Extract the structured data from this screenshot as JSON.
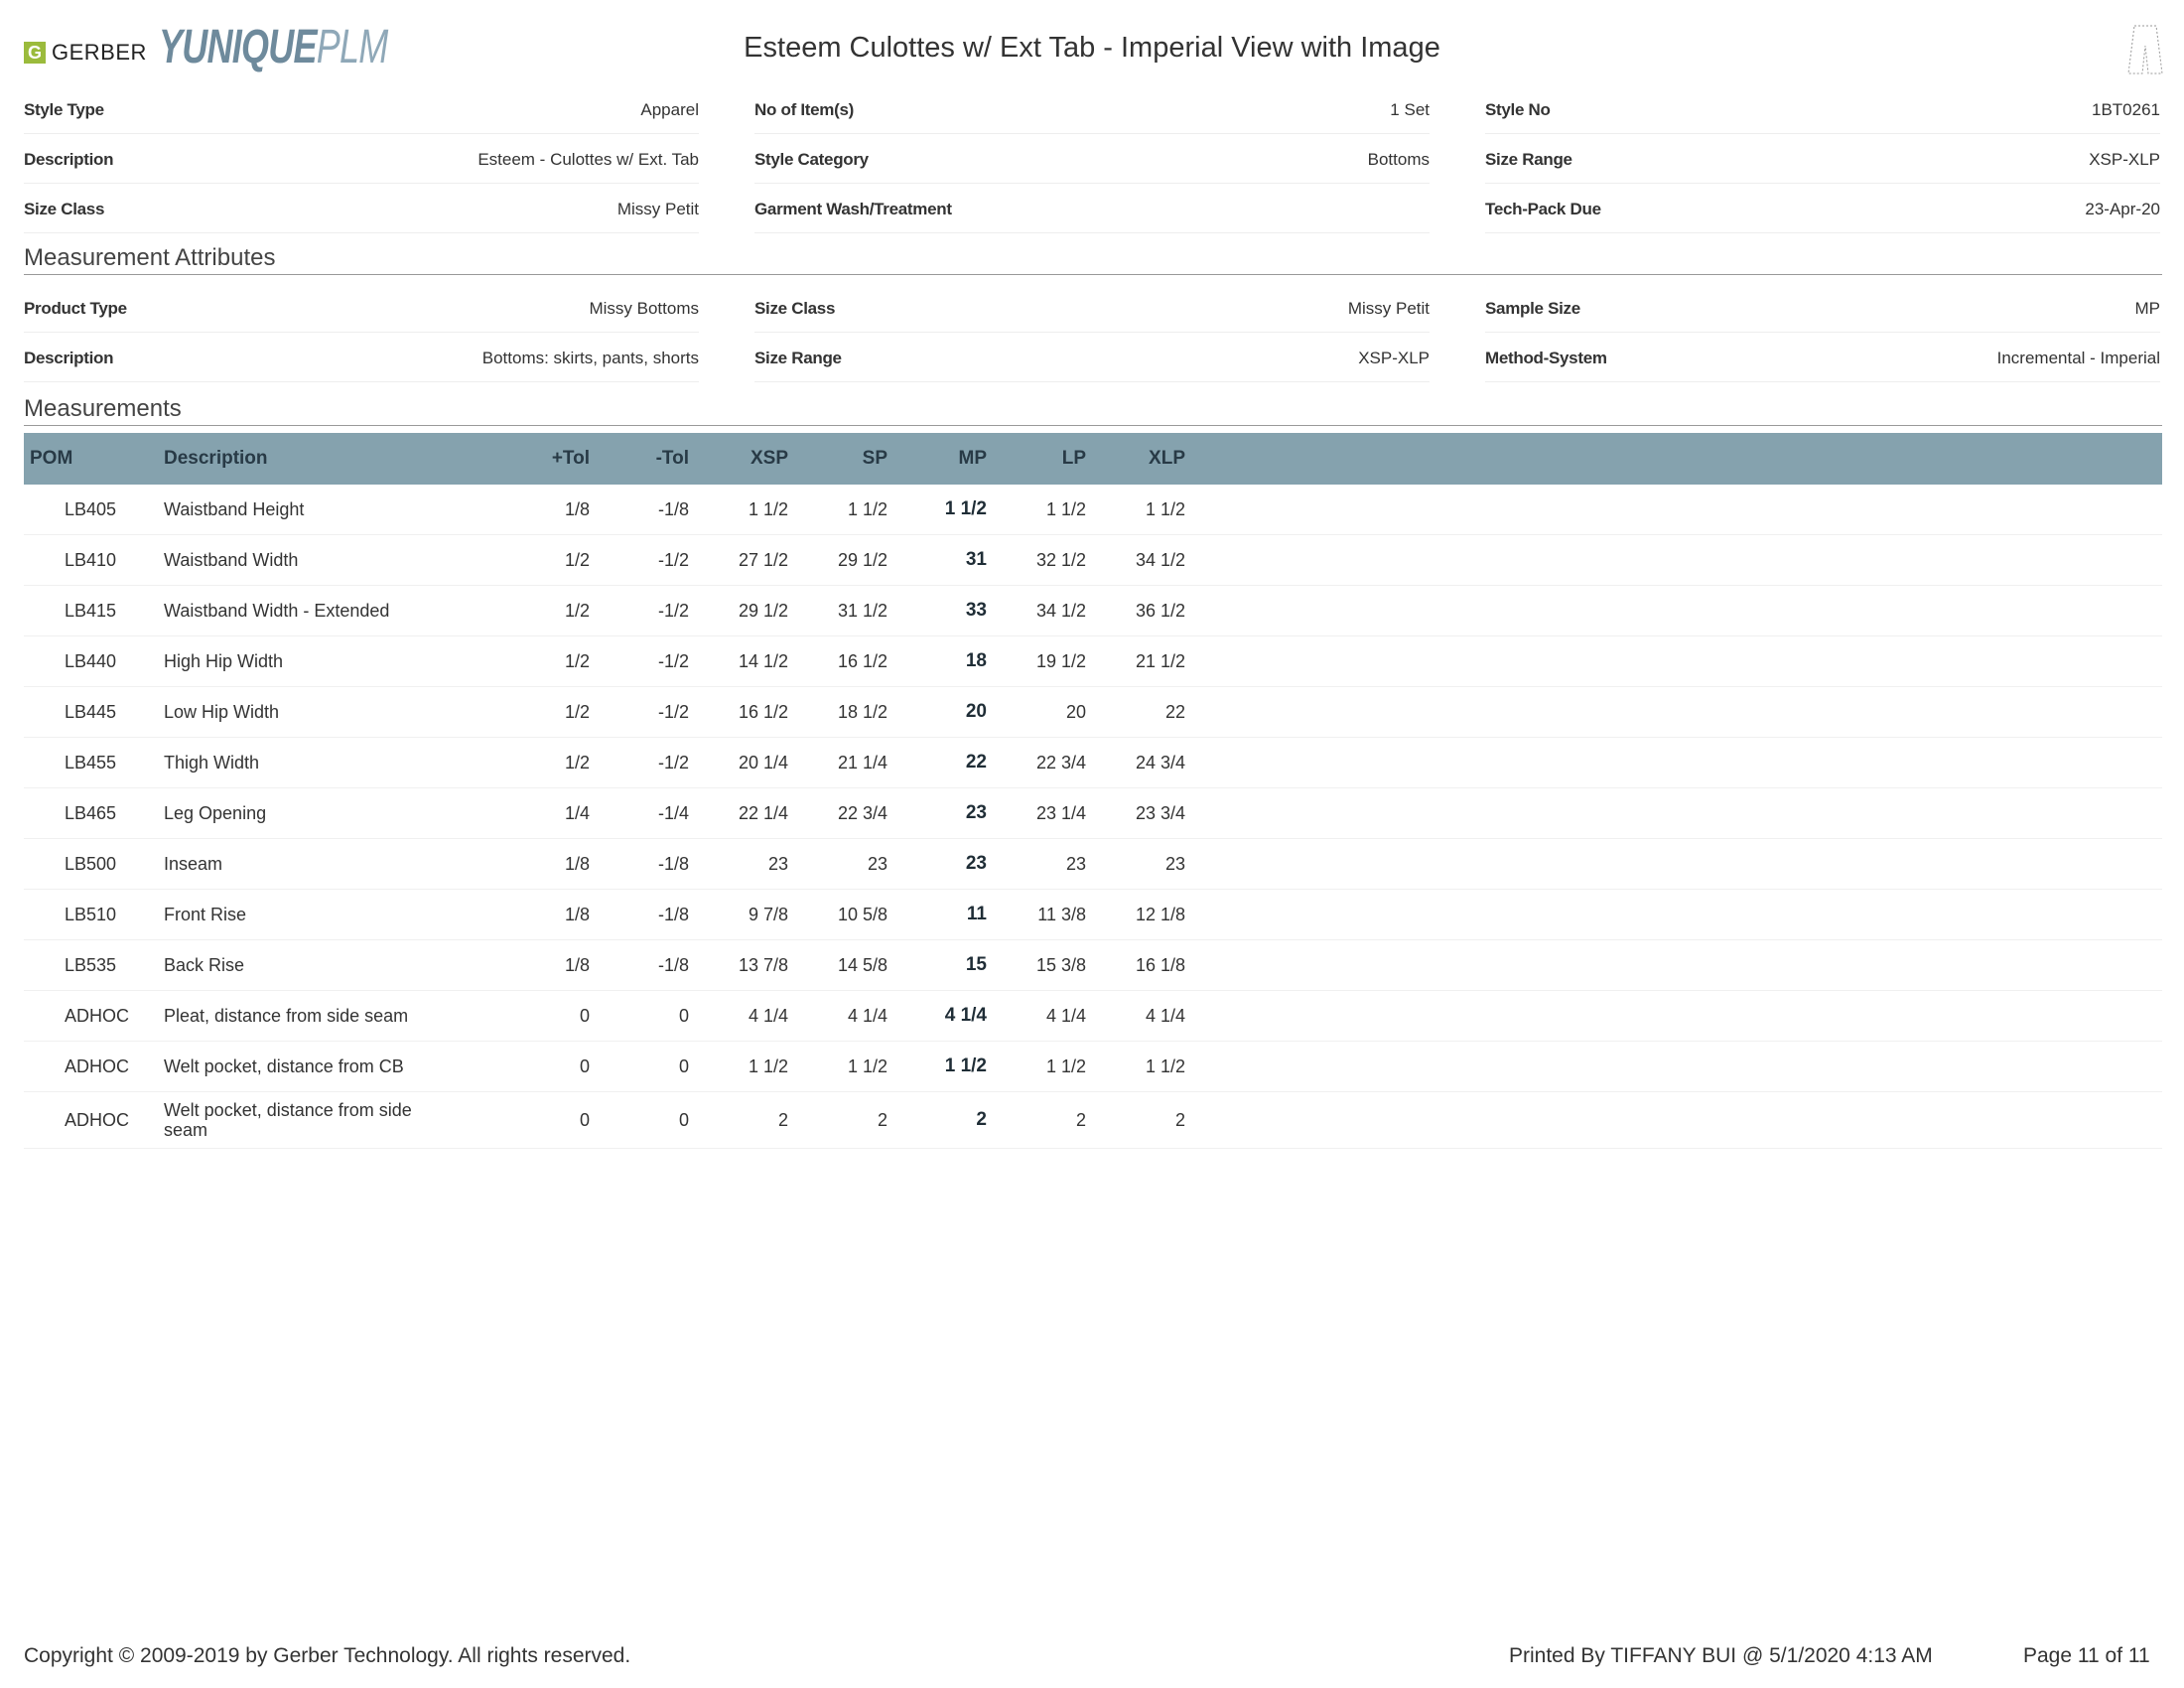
{
  "header": {
    "gerber_logo_text": "GERBER",
    "product_logo_main": "YUNIQUE",
    "product_logo_suffix": "PLM",
    "title": "Esteem Culottes w/ Ext Tab - Imperial View with Image"
  },
  "style_info": [
    [
      {
        "label": "Style Type",
        "value": "Apparel"
      },
      {
        "label": "No of Item(s)",
        "value": "1 Set"
      },
      {
        "label": "Style No",
        "value": "1BT0261"
      }
    ],
    [
      {
        "label": "Description",
        "value": "Esteem - Culottes w/ Ext. Tab"
      },
      {
        "label": "Style Category",
        "value": "Bottoms"
      },
      {
        "label": "Size Range",
        "value": "XSP-XLP"
      }
    ],
    [
      {
        "label": "Size Class",
        "value": "Missy Petit"
      },
      {
        "label": "Garment Wash/Treatment",
        "value": ""
      },
      {
        "label": "Tech-Pack Due",
        "value": "23-Apr-20"
      }
    ]
  ],
  "measurement_attributes": {
    "heading": "Measurement Attributes",
    "rows": [
      [
        {
          "label": "Product Type",
          "value": "Missy Bottoms"
        },
        {
          "label": "Size Class",
          "value": "Missy Petit"
        },
        {
          "label": "Sample Size",
          "value": "MP"
        }
      ],
      [
        {
          "label": "Description",
          "value": "Bottoms: skirts, pants, shorts"
        },
        {
          "label": "Size Range",
          "value": "XSP-XLP"
        },
        {
          "label": "Method-System",
          "value": "Incremental - Imperial"
        }
      ]
    ]
  },
  "measurements": {
    "heading": "Measurements",
    "columns": [
      "POM",
      "Description",
      "+Tol",
      "-Tol",
      "XSP",
      "SP",
      "MP",
      "LP",
      "XLP"
    ],
    "rows": [
      [
        "LB405",
        "Waistband Height",
        "1/8",
        "-1/8",
        "1 1/2",
        "1 1/2",
        "1 1/2",
        "1 1/2",
        "1 1/2"
      ],
      [
        "LB410",
        "Waistband Width",
        "1/2",
        "-1/2",
        "27 1/2",
        "29 1/2",
        "31",
        "32 1/2",
        "34 1/2"
      ],
      [
        "LB415",
        "Waistband Width - Extended",
        "1/2",
        "-1/2",
        "29 1/2",
        "31 1/2",
        "33",
        "34 1/2",
        "36 1/2"
      ],
      [
        "LB440",
        "High Hip Width",
        "1/2",
        "-1/2",
        "14 1/2",
        "16 1/2",
        "18",
        "19 1/2",
        "21 1/2"
      ],
      [
        "LB445",
        "Low Hip Width",
        "1/2",
        "-1/2",
        "16 1/2",
        "18 1/2",
        "20",
        "20",
        "22"
      ],
      [
        "LB455",
        "Thigh Width",
        "1/2",
        "-1/2",
        "20 1/4",
        "21 1/4",
        "22",
        "22 3/4",
        "24 3/4"
      ],
      [
        "LB465",
        "Leg Opening",
        "1/4",
        "-1/4",
        "22 1/4",
        "22 3/4",
        "23",
        "23 1/4",
        "23 3/4"
      ],
      [
        "LB500",
        "Inseam",
        "1/8",
        "-1/8",
        "23",
        "23",
        "23",
        "23",
        "23"
      ],
      [
        "LB510",
        "Front Rise",
        "1/8",
        "-1/8",
        "9 7/8",
        "10 5/8",
        "11",
        "11 3/8",
        "12 1/8"
      ],
      [
        "LB535",
        "Back Rise",
        "1/8",
        "-1/8",
        "13 7/8",
        "14 5/8",
        "15",
        "15 3/8",
        "16 1/8"
      ],
      [
        "ADHOC",
        "Pleat, distance from side seam",
        "0",
        "0",
        "4 1/4",
        "4 1/4",
        "4 1/4",
        "4 1/4",
        "4 1/4"
      ],
      [
        "ADHOC",
        "Welt pocket, distance from CB",
        "0",
        "0",
        "1 1/2",
        "1 1/2",
        "1 1/2",
        "1 1/2",
        "1 1/2"
      ],
      [
        "ADHOC",
        "Welt pocket, distance from side seam",
        "0",
        "0",
        "2",
        "2",
        "2",
        "2",
        "2"
      ]
    ]
  },
  "footer": {
    "copyright": "Copyright © 2009-2019 by Gerber Technology. All rights reserved.",
    "printed_by": "Printed By TIFFANY BUI @ 5/1/2020 4:13 AM",
    "page": "Page 11 of 11"
  },
  "colors": {
    "table_header_bg": "#85a2ae",
    "gerber_green": "#9bbb3c",
    "yunique_blue": "#6e8a9c"
  }
}
